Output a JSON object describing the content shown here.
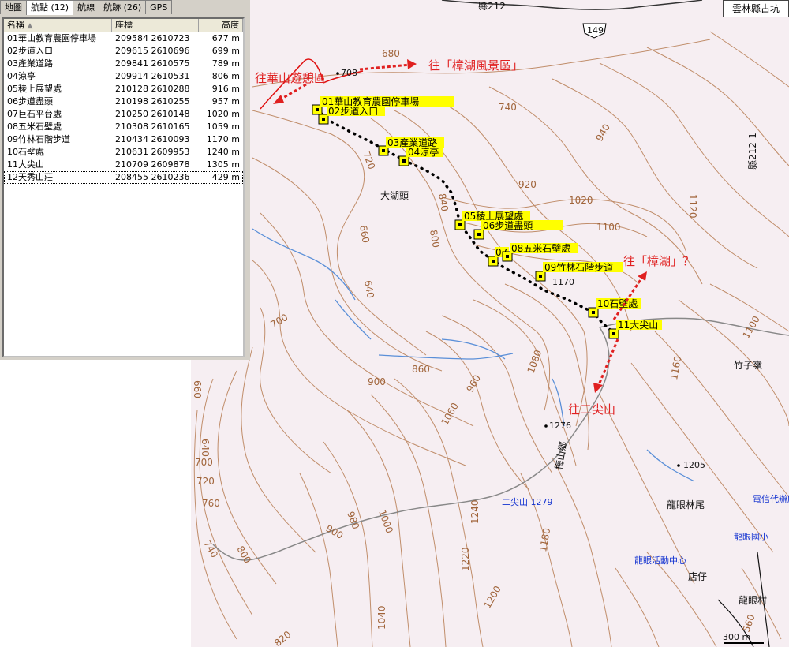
{
  "tabs": [
    {
      "label": "地圖",
      "active": false
    },
    {
      "label": "航點 (12)",
      "active": true
    },
    {
      "label": "航線",
      "active": false
    },
    {
      "label": "航跡 (26)",
      "active": false
    },
    {
      "label": "GPS",
      "active": false
    }
  ],
  "columns": {
    "name": "名稱",
    "coord": "座標",
    "elev": "高度"
  },
  "waypoints": [
    {
      "name": "01華山教育農園停車場",
      "coord": "209584 2610723",
      "elev": "677 m"
    },
    {
      "name": "02步道入口",
      "coord": "209615 2610696",
      "elev": "699 m"
    },
    {
      "name": "03產業道路",
      "coord": "209841 2610575",
      "elev": "789 m"
    },
    {
      "name": "04涼亭",
      "coord": "209914 2610531",
      "elev": "806 m"
    },
    {
      "name": "05稜上展望處",
      "coord": "210128 2610288",
      "elev": "916 m"
    },
    {
      "name": "06步道盡頭",
      "coord": "210198 2610255",
      "elev": "957 m"
    },
    {
      "name": "07巨石平台處",
      "coord": "210250 2610148",
      "elev": "1020 m"
    },
    {
      "name": "08五米石壁處",
      "coord": "210308 2610165",
      "elev": "1059 m"
    },
    {
      "name": "09竹林石階步道",
      "coord": "210434 2610093",
      "elev": "1170 m"
    },
    {
      "name": "10石壁處",
      "coord": "210631 2609953",
      "elev": "1240 m"
    },
    {
      "name": "11大尖山",
      "coord": "210709 2609878",
      "elev": "1305 m"
    },
    {
      "name": "12天秀山莊",
      "coord": "208455 2610236",
      "elev": "429 m"
    }
  ],
  "map": {
    "corner_label": "雲林縣古坑",
    "road_labels": [
      "縣212",
      "149",
      "縣212-1"
    ],
    "annotations": {
      "west": "往華山遊憩區",
      "east": "往「樟湖風景區」",
      "northeast": "往「樟湖」？",
      "south": "往二尖山"
    },
    "waypoint_labels": [
      "01華山教育農園停車場",
      "02步道入口",
      "03產業道路",
      "04涼亭",
      "05稜上展望處",
      "06步道盡頭",
      "07",
      "08五米石壁處",
      "09竹林石階步道",
      "10石壁處",
      "11大尖山"
    ],
    "places": [
      "大湖頭",
      "竹子嶺",
      "龍眼林尾",
      "店仔",
      "龍眼村",
      "梅山鄉"
    ],
    "blue_labels": [
      "二尖山 1279",
      "電信代辦所",
      "龍眼國小",
      "龍眼活動中心"
    ],
    "spot_heights": [
      "708",
      "1276",
      "1205",
      "1170"
    ],
    "contour_labels": [
      "680",
      "740",
      "720",
      "660",
      "640",
      "700",
      "800",
      "840",
      "860",
      "900",
      "920",
      "940",
      "960",
      "980",
      "1000",
      "1020",
      "1040",
      "1060",
      "1080",
      "1100",
      "1120",
      "1160",
      "1180",
      "1200",
      "1220",
      "1240",
      "760",
      "820",
      "560"
    ],
    "scale": "300 m",
    "colors": {
      "background": "#f6eef2",
      "contour": "#c08d6a",
      "track": "#000000",
      "annotation": "#e02020",
      "stream": "#5a8fd8",
      "wpt_label_bg": "#ffff00"
    }
  }
}
